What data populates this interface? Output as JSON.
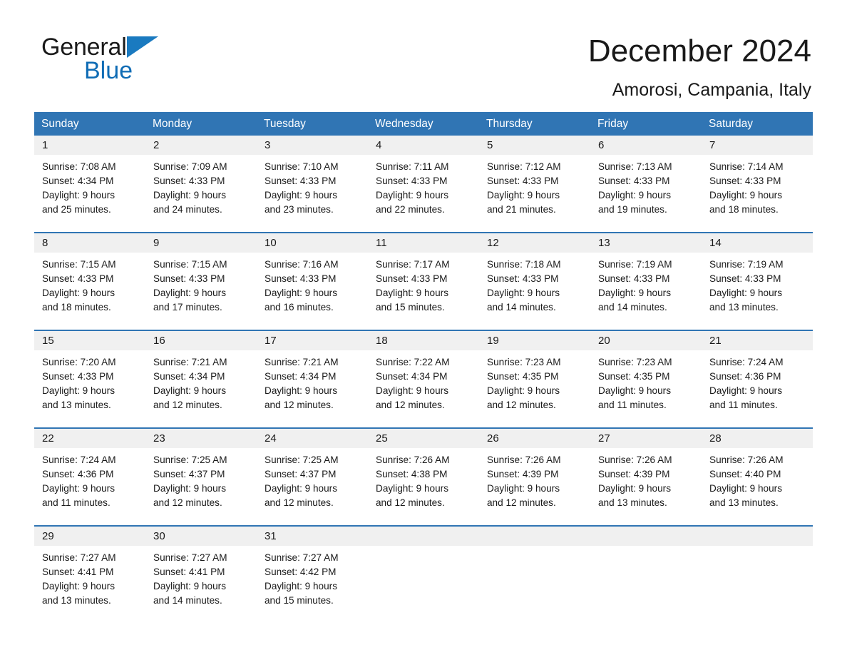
{
  "brand": {
    "name_part1": "General",
    "name_part2": "Blue",
    "triangle_icon": "blue-triangle-icon",
    "accent_color": "#0f6cb5"
  },
  "header": {
    "month_title": "December 2024",
    "location": "Amorosi, Campania, Italy"
  },
  "theme": {
    "header_blue": "#3075b4",
    "daynum_band": "#f0f0f0",
    "text": "#1a1a1a"
  },
  "weekdays": [
    "Sunday",
    "Monday",
    "Tuesday",
    "Wednesday",
    "Thursday",
    "Friday",
    "Saturday"
  ],
  "weeks": [
    {
      "days": [
        {
          "num": "1",
          "sunrise": "Sunrise: 7:08 AM",
          "sunset": "Sunset: 4:34 PM",
          "daylight1": "Daylight: 9 hours",
          "daylight2": "and 25 minutes."
        },
        {
          "num": "2",
          "sunrise": "Sunrise: 7:09 AM",
          "sunset": "Sunset: 4:33 PM",
          "daylight1": "Daylight: 9 hours",
          "daylight2": "and 24 minutes."
        },
        {
          "num": "3",
          "sunrise": "Sunrise: 7:10 AM",
          "sunset": "Sunset: 4:33 PM",
          "daylight1": "Daylight: 9 hours",
          "daylight2": "and 23 minutes."
        },
        {
          "num": "4",
          "sunrise": "Sunrise: 7:11 AM",
          "sunset": "Sunset: 4:33 PM",
          "daylight1": "Daylight: 9 hours",
          "daylight2": "and 22 minutes."
        },
        {
          "num": "5",
          "sunrise": "Sunrise: 7:12 AM",
          "sunset": "Sunset: 4:33 PM",
          "daylight1": "Daylight: 9 hours",
          "daylight2": "and 21 minutes."
        },
        {
          "num": "6",
          "sunrise": "Sunrise: 7:13 AM",
          "sunset": "Sunset: 4:33 PM",
          "daylight1": "Daylight: 9 hours",
          "daylight2": "and 19 minutes."
        },
        {
          "num": "7",
          "sunrise": "Sunrise: 7:14 AM",
          "sunset": "Sunset: 4:33 PM",
          "daylight1": "Daylight: 9 hours",
          "daylight2": "and 18 minutes."
        }
      ]
    },
    {
      "days": [
        {
          "num": "8",
          "sunrise": "Sunrise: 7:15 AM",
          "sunset": "Sunset: 4:33 PM",
          "daylight1": "Daylight: 9 hours",
          "daylight2": "and 18 minutes."
        },
        {
          "num": "9",
          "sunrise": "Sunrise: 7:15 AM",
          "sunset": "Sunset: 4:33 PM",
          "daylight1": "Daylight: 9 hours",
          "daylight2": "and 17 minutes."
        },
        {
          "num": "10",
          "sunrise": "Sunrise: 7:16 AM",
          "sunset": "Sunset: 4:33 PM",
          "daylight1": "Daylight: 9 hours",
          "daylight2": "and 16 minutes."
        },
        {
          "num": "11",
          "sunrise": "Sunrise: 7:17 AM",
          "sunset": "Sunset: 4:33 PM",
          "daylight1": "Daylight: 9 hours",
          "daylight2": "and 15 minutes."
        },
        {
          "num": "12",
          "sunrise": "Sunrise: 7:18 AM",
          "sunset": "Sunset: 4:33 PM",
          "daylight1": "Daylight: 9 hours",
          "daylight2": "and 14 minutes."
        },
        {
          "num": "13",
          "sunrise": "Sunrise: 7:19 AM",
          "sunset": "Sunset: 4:33 PM",
          "daylight1": "Daylight: 9 hours",
          "daylight2": "and 14 minutes."
        },
        {
          "num": "14",
          "sunrise": "Sunrise: 7:19 AM",
          "sunset": "Sunset: 4:33 PM",
          "daylight1": "Daylight: 9 hours",
          "daylight2": "and 13 minutes."
        }
      ]
    },
    {
      "days": [
        {
          "num": "15",
          "sunrise": "Sunrise: 7:20 AM",
          "sunset": "Sunset: 4:33 PM",
          "daylight1": "Daylight: 9 hours",
          "daylight2": "and 13 minutes."
        },
        {
          "num": "16",
          "sunrise": "Sunrise: 7:21 AM",
          "sunset": "Sunset: 4:34 PM",
          "daylight1": "Daylight: 9 hours",
          "daylight2": "and 12 minutes."
        },
        {
          "num": "17",
          "sunrise": "Sunrise: 7:21 AM",
          "sunset": "Sunset: 4:34 PM",
          "daylight1": "Daylight: 9 hours",
          "daylight2": "and 12 minutes."
        },
        {
          "num": "18",
          "sunrise": "Sunrise: 7:22 AM",
          "sunset": "Sunset: 4:34 PM",
          "daylight1": "Daylight: 9 hours",
          "daylight2": "and 12 minutes."
        },
        {
          "num": "19",
          "sunrise": "Sunrise: 7:23 AM",
          "sunset": "Sunset: 4:35 PM",
          "daylight1": "Daylight: 9 hours",
          "daylight2": "and 12 minutes."
        },
        {
          "num": "20",
          "sunrise": "Sunrise: 7:23 AM",
          "sunset": "Sunset: 4:35 PM",
          "daylight1": "Daylight: 9 hours",
          "daylight2": "and 11 minutes."
        },
        {
          "num": "21",
          "sunrise": "Sunrise: 7:24 AM",
          "sunset": "Sunset: 4:36 PM",
          "daylight1": "Daylight: 9 hours",
          "daylight2": "and 11 minutes."
        }
      ]
    },
    {
      "days": [
        {
          "num": "22",
          "sunrise": "Sunrise: 7:24 AM",
          "sunset": "Sunset: 4:36 PM",
          "daylight1": "Daylight: 9 hours",
          "daylight2": "and 11 minutes."
        },
        {
          "num": "23",
          "sunrise": "Sunrise: 7:25 AM",
          "sunset": "Sunset: 4:37 PM",
          "daylight1": "Daylight: 9 hours",
          "daylight2": "and 12 minutes."
        },
        {
          "num": "24",
          "sunrise": "Sunrise: 7:25 AM",
          "sunset": "Sunset: 4:37 PM",
          "daylight1": "Daylight: 9 hours",
          "daylight2": "and 12 minutes."
        },
        {
          "num": "25",
          "sunrise": "Sunrise: 7:26 AM",
          "sunset": "Sunset: 4:38 PM",
          "daylight1": "Daylight: 9 hours",
          "daylight2": "and 12 minutes."
        },
        {
          "num": "26",
          "sunrise": "Sunrise: 7:26 AM",
          "sunset": "Sunset: 4:39 PM",
          "daylight1": "Daylight: 9 hours",
          "daylight2": "and 12 minutes."
        },
        {
          "num": "27",
          "sunrise": "Sunrise: 7:26 AM",
          "sunset": "Sunset: 4:39 PM",
          "daylight1": "Daylight: 9 hours",
          "daylight2": "and 13 minutes."
        },
        {
          "num": "28",
          "sunrise": "Sunrise: 7:26 AM",
          "sunset": "Sunset: 4:40 PM",
          "daylight1": "Daylight: 9 hours",
          "daylight2": "and 13 minutes."
        }
      ]
    },
    {
      "days": [
        {
          "num": "29",
          "sunrise": "Sunrise: 7:27 AM",
          "sunset": "Sunset: 4:41 PM",
          "daylight1": "Daylight: 9 hours",
          "daylight2": "and 13 minutes."
        },
        {
          "num": "30",
          "sunrise": "Sunrise: 7:27 AM",
          "sunset": "Sunset: 4:41 PM",
          "daylight1": "Daylight: 9 hours",
          "daylight2": "and 14 minutes."
        },
        {
          "num": "31",
          "sunrise": "Sunrise: 7:27 AM",
          "sunset": "Sunset: 4:42 PM",
          "daylight1": "Daylight: 9 hours",
          "daylight2": "and 15 minutes."
        },
        {
          "num": "",
          "sunrise": "",
          "sunset": "",
          "daylight1": "",
          "daylight2": ""
        },
        {
          "num": "",
          "sunrise": "",
          "sunset": "",
          "daylight1": "",
          "daylight2": ""
        },
        {
          "num": "",
          "sunrise": "",
          "sunset": "",
          "daylight1": "",
          "daylight2": ""
        },
        {
          "num": "",
          "sunrise": "",
          "sunset": "",
          "daylight1": "",
          "daylight2": ""
        }
      ]
    }
  ]
}
